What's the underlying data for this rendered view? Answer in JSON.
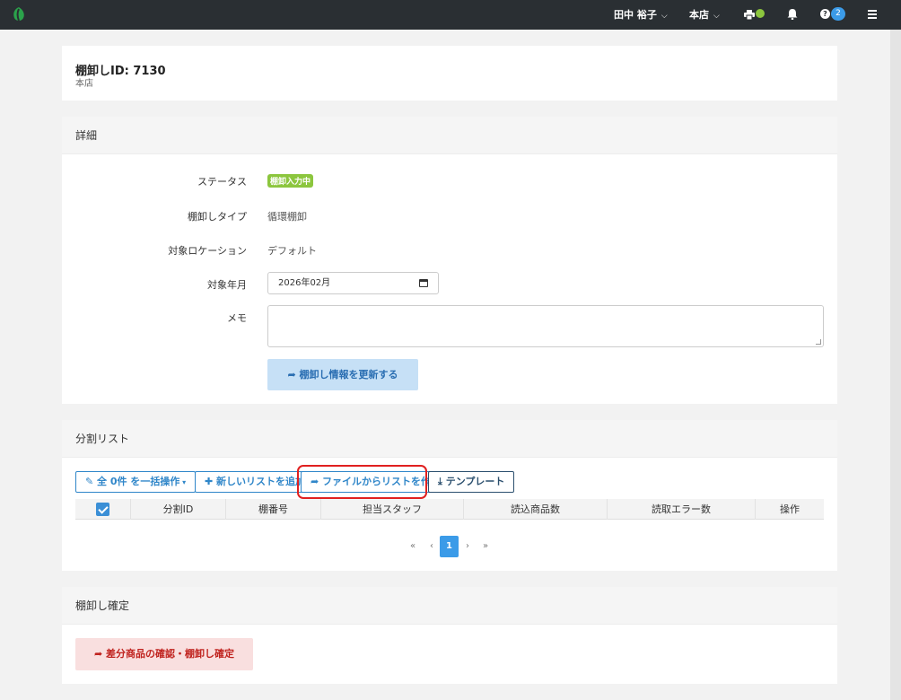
{
  "nav": {
    "user": "田中 裕子",
    "store": "本店",
    "help_count": "2",
    "colors": {
      "bar": "#2a2f33",
      "status_dot": "#8cc63e",
      "badge": "#3b9be8"
    }
  },
  "header": {
    "title": "棚卸しID: 7130",
    "subtitle": "本店"
  },
  "details": {
    "section_title": "詳細",
    "status_label": "ステータス",
    "status_value": "棚卸入力中",
    "type_label": "棚卸しタイプ",
    "type_value": "循環棚卸",
    "location_label": "対象ロケーション",
    "location_value": "デフォルト",
    "month_label": "対象年月",
    "month_value": "2026年02月",
    "memo_label": "メモ",
    "memo_value": "",
    "update_button": "棚卸し情報を更新する"
  },
  "split_list": {
    "section_title": "分割リスト",
    "bulk_button": "全 0件 を一括操作",
    "add_button": "新しいリストを追加",
    "file_button": "ファイルからリストを作成",
    "template_button": "テンプレート",
    "columns": [
      "分割ID",
      "棚番号",
      "担当スタッフ",
      "読込商品数",
      "読取エラー数",
      "操作"
    ],
    "pagination": {
      "first": "«",
      "prev": "‹",
      "current": "1",
      "next": "›",
      "last": "»"
    }
  },
  "confirm": {
    "section_title": "棚卸し確定",
    "button": "差分商品の確認・棚卸し確定"
  }
}
